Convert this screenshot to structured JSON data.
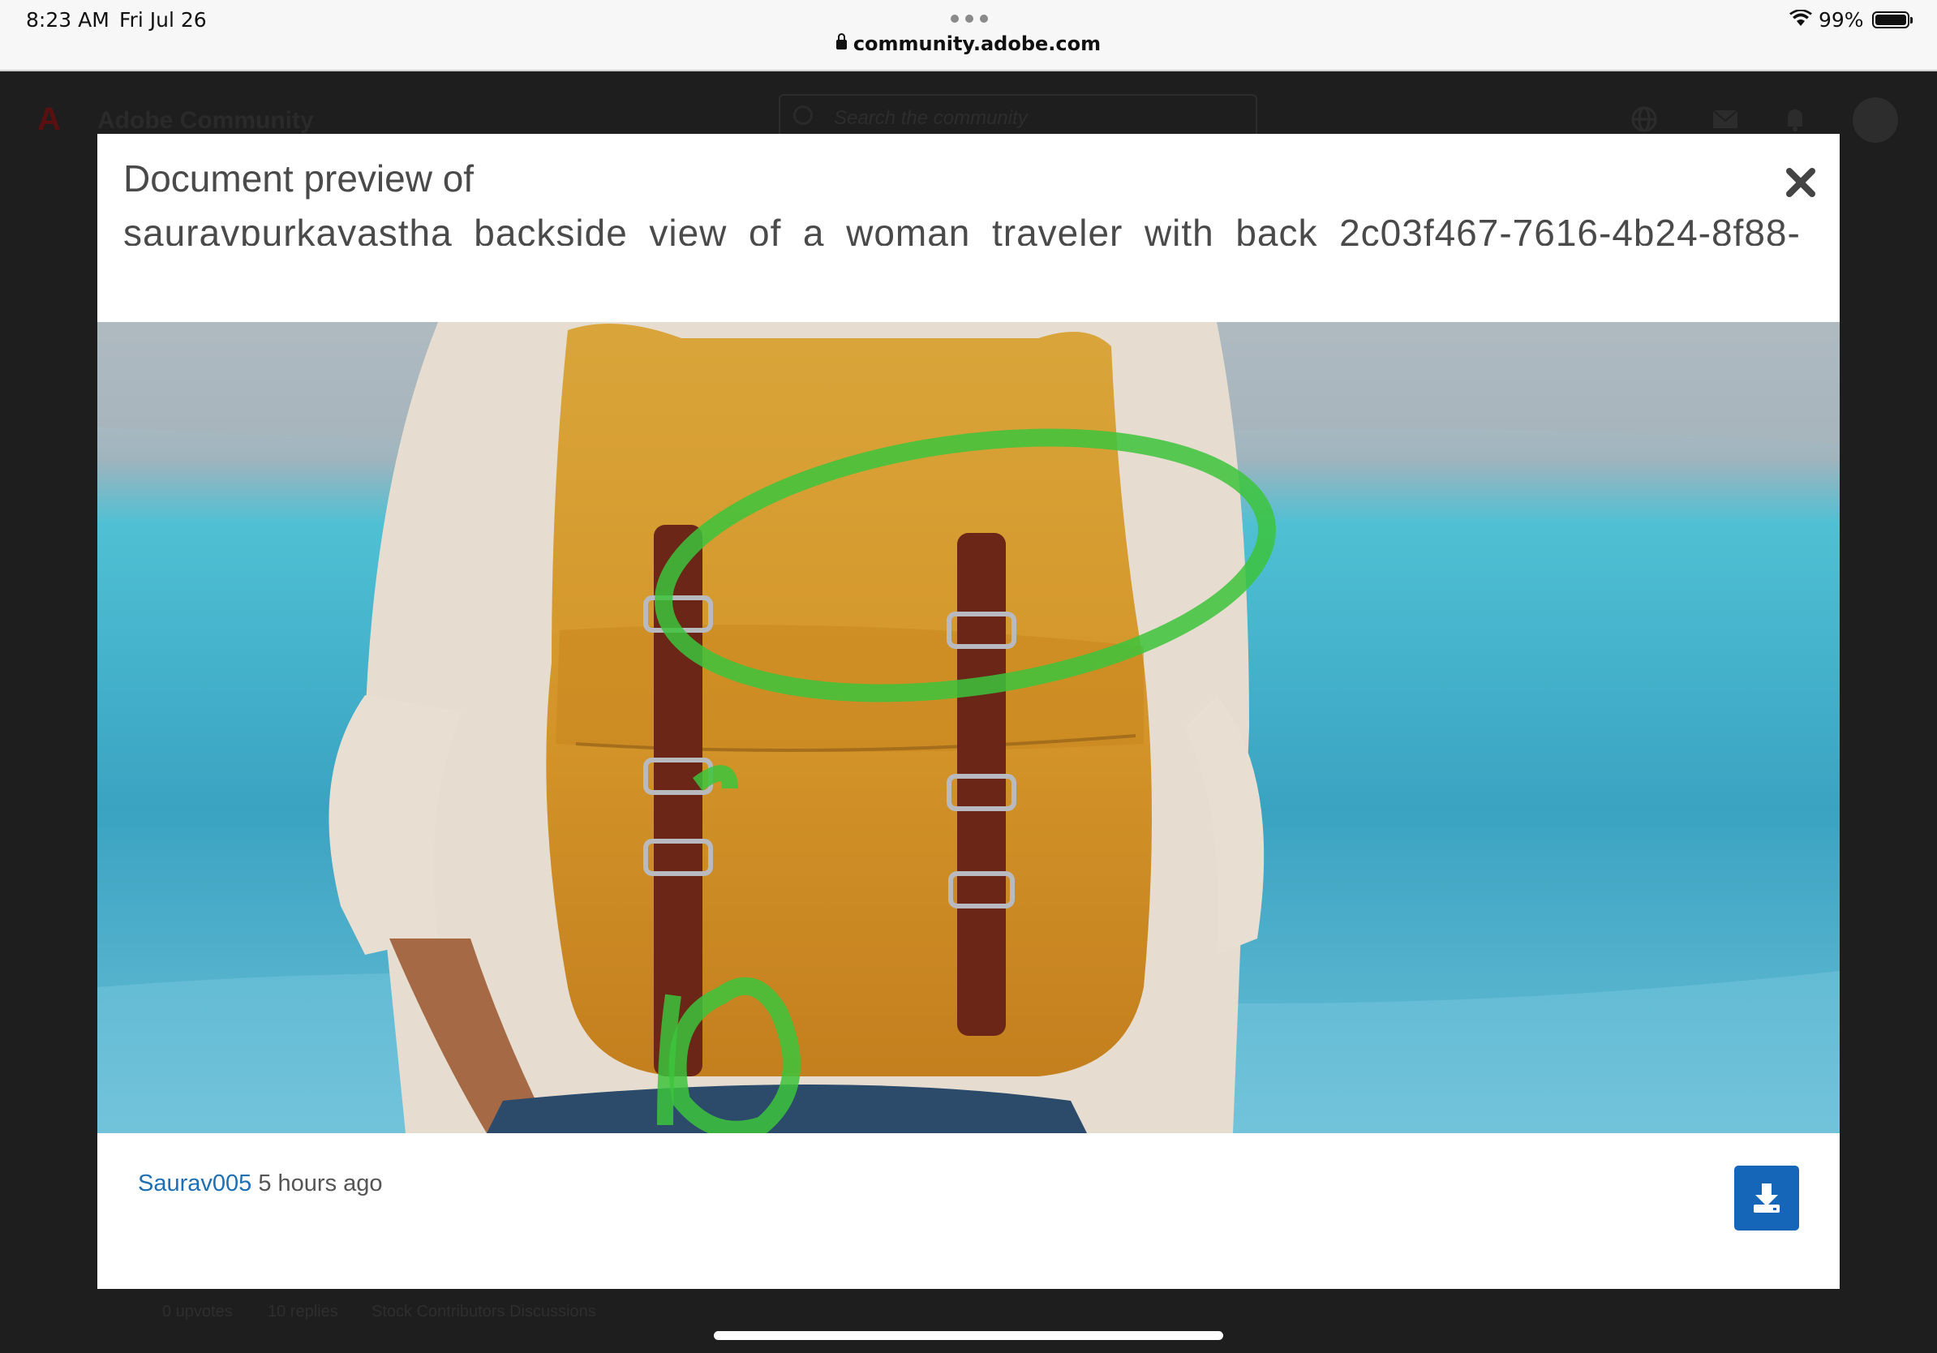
{
  "status_bar": {
    "time": "8:23 AM",
    "date": "Fri Jul 26",
    "url": "community.adobe.com",
    "battery": "99%",
    "battery_level": 0.99
  },
  "background_page": {
    "site_title": "Adobe Community",
    "search_placeholder": "Search the community",
    "footer": {
      "upvotes": "0 upvotes",
      "replies": "10 replies",
      "board": "Stock Contributors Discussions"
    }
  },
  "modal": {
    "title": "Document preview of",
    "filename": "sauravpurkayastha_backside_view_of_a_woman_traveler_with_back_2c03f467-7616-4b24-8f88-",
    "author": "Saurav005",
    "posted": "5 hours ago",
    "annotation_text": "10"
  },
  "colors": {
    "link": "#1f6fb5",
    "download_button": "#1565b8",
    "annotation": "#3cc43c"
  },
  "icons": {
    "close": "close-icon",
    "download": "download-icon",
    "lock": "lock-icon",
    "wifi": "wifi-icon",
    "battery": "battery-icon"
  }
}
